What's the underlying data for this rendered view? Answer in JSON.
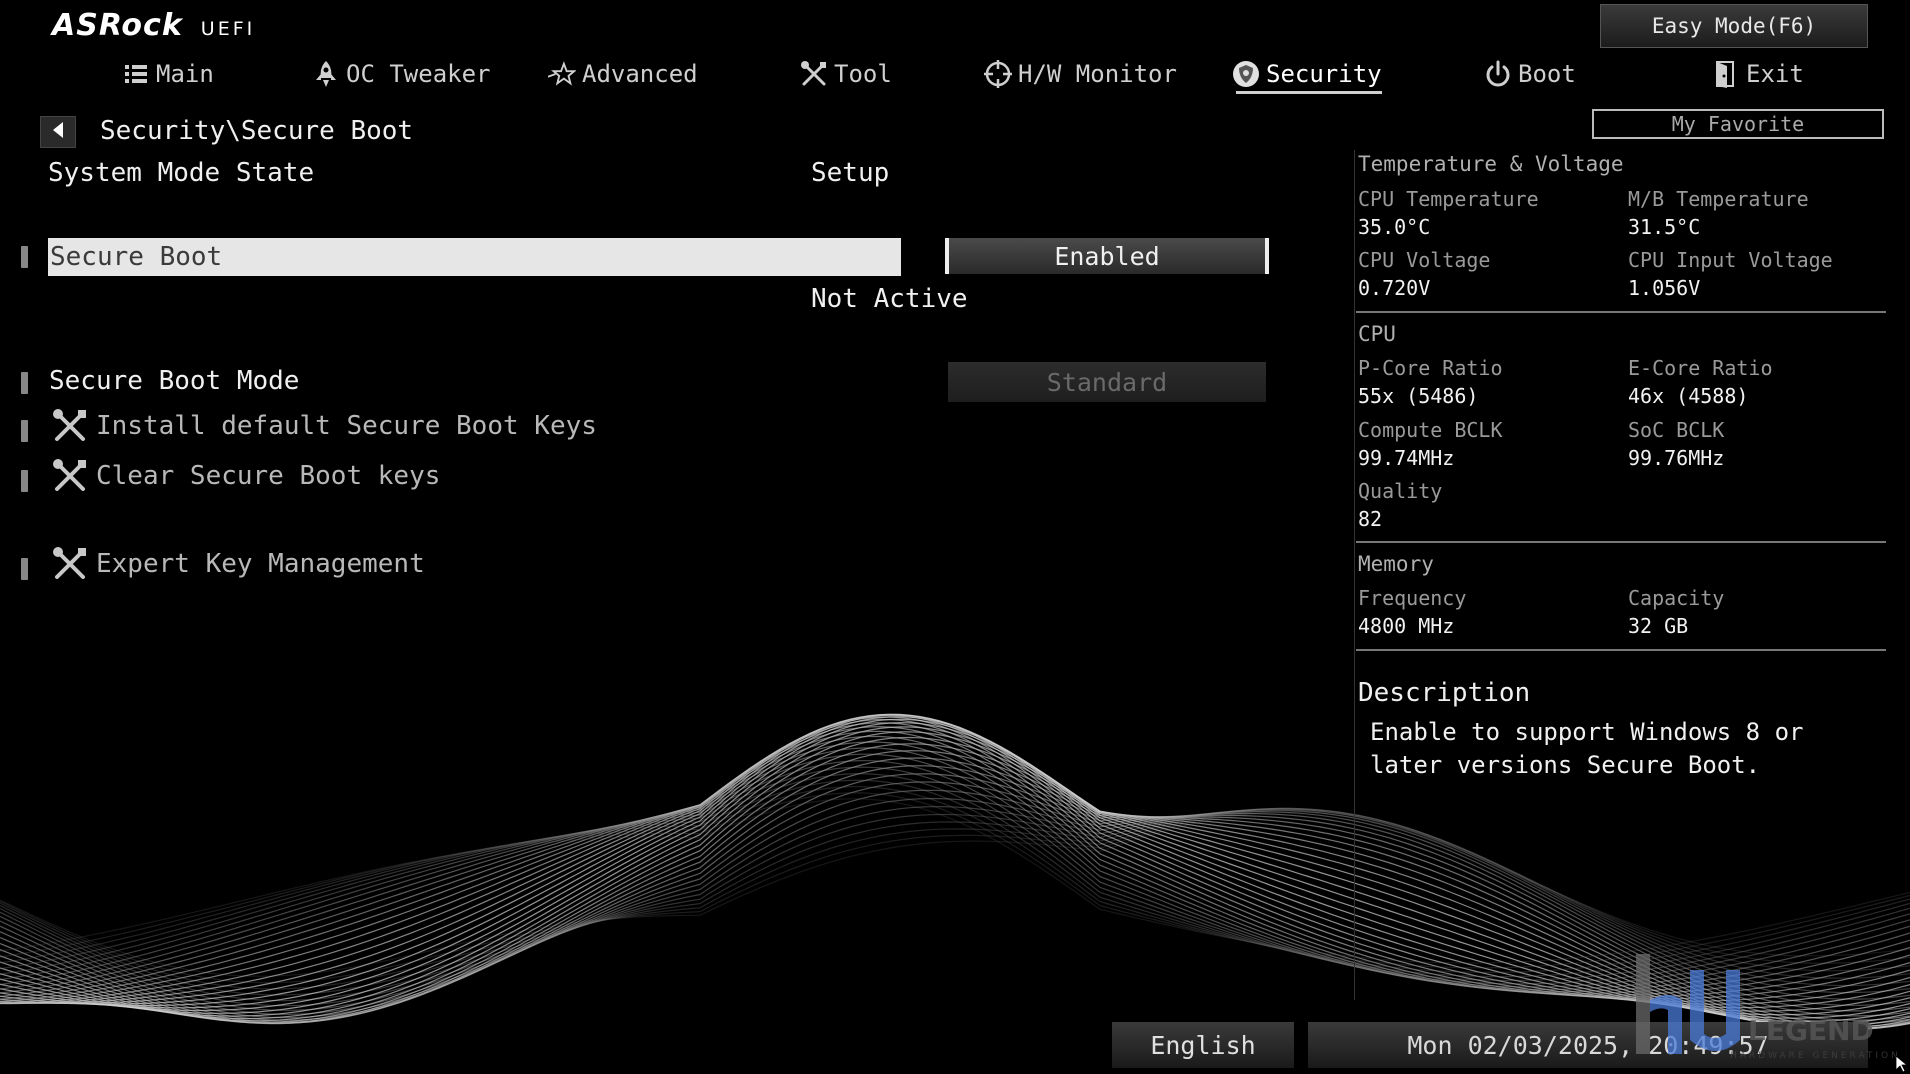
{
  "header": {
    "logo_brand": "ASRock",
    "logo_sub": "UEFI",
    "easy_mode_label": "Easy Mode(F6)",
    "my_favorite_label": "My Favorite"
  },
  "nav": {
    "tabs": [
      {
        "label": "Main",
        "icon": "list-icon"
      },
      {
        "label": "OC Tweaker",
        "icon": "rocket-icon"
      },
      {
        "label": "Advanced",
        "icon": "star-icon"
      },
      {
        "label": "Tool",
        "icon": "tools-icon"
      },
      {
        "label": "H/W Monitor",
        "icon": "crosshair-icon"
      },
      {
        "label": "Security",
        "icon": "shield-icon"
      },
      {
        "label": "Boot",
        "icon": "power-icon"
      },
      {
        "label": "Exit",
        "icon": "exit-door-icon"
      }
    ],
    "active": "Security"
  },
  "main": {
    "breadcrumb": "Security\\Secure Boot",
    "system_mode_label": "System Mode State",
    "system_mode_value": "Setup",
    "secure_boot_label": "Secure Boot",
    "secure_boot_value": "Enabled",
    "secure_boot_status": "Not Active",
    "secure_boot_mode_label": "Secure Boot Mode",
    "secure_boot_mode_value": "Standard",
    "install_keys_label": "Install default Secure Boot Keys",
    "clear_keys_label": "Clear Secure Boot keys",
    "expert_key_label": "Expert Key Management"
  },
  "panel": {
    "temp_voltage": {
      "title": "Temperature & Voltage",
      "cpu_temp_label": "CPU Temperature",
      "cpu_temp_value": "35.0°C",
      "mb_temp_label": "M/B Temperature",
      "mb_temp_value": "31.5°C",
      "cpu_voltage_label": "CPU Voltage",
      "cpu_voltage_value": "0.720V",
      "cpu_input_voltage_label": "CPU Input Voltage",
      "cpu_input_voltage_value": "1.056V"
    },
    "cpu": {
      "title": "CPU",
      "pcore_label": "P-Core Ratio",
      "pcore_value": "55x (5486)",
      "ecore_label": "E-Core Ratio",
      "ecore_value": "46x (4588)",
      "compute_bclk_label": "Compute BCLK",
      "compute_bclk_value": "99.74MHz",
      "soc_bclk_label": "SoC BCLK",
      "soc_bclk_value": "99.76MHz",
      "quality_label": "Quality",
      "quality_value": "82"
    },
    "memory": {
      "title": "Memory",
      "frequency_label": "Frequency",
      "frequency_value": "4800 MHz",
      "capacity_label": "Capacity",
      "capacity_value": "32 GB"
    },
    "description": {
      "title": "Description",
      "text": "Enable to support Windows 8 or later versions Secure Boot."
    }
  },
  "footer": {
    "language": "English",
    "datetime": "Mon 02/03/2025, 20:49:57"
  },
  "watermark": {
    "mark": "HU",
    "word": "LEGEND",
    "tagline": "HARDWARE GENERATION"
  }
}
